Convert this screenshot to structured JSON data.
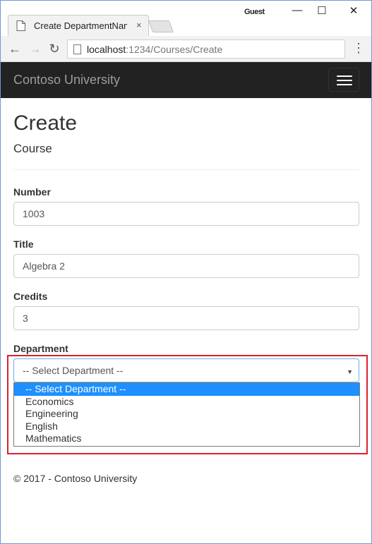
{
  "browser": {
    "tab_title": "Create DepartmentName",
    "tab_close": "×",
    "profile": "Guest",
    "controls": {
      "minimize": "—",
      "maximize": "☐",
      "close": "✕"
    },
    "nav": {
      "back": "←",
      "forward": "→",
      "reload": "↻"
    },
    "url_host": "localhost",
    "url_path": ":1234/Courses/Create",
    "menu": "⋮"
  },
  "site": {
    "brand": "Contoso University"
  },
  "page": {
    "title": "Create",
    "subtitle": "Course"
  },
  "form": {
    "number": {
      "label": "Number",
      "value": "1003"
    },
    "title": {
      "label": "Title",
      "value": "Algebra 2"
    },
    "credits": {
      "label": "Credits",
      "value": "3"
    },
    "department": {
      "label": "Department",
      "selected": "-- Select Department --",
      "arrow": "▼",
      "options": [
        "-- Select Department --",
        "Economics",
        "Engineering",
        "English",
        "Mathematics"
      ],
      "highlighted_index": 0
    }
  },
  "footer": {
    "text": "© 2017 - Contoso University"
  },
  "colors": {
    "navbar": "#222222",
    "highlight_border": "#d9232d",
    "selected_option": "#1e90ff"
  }
}
